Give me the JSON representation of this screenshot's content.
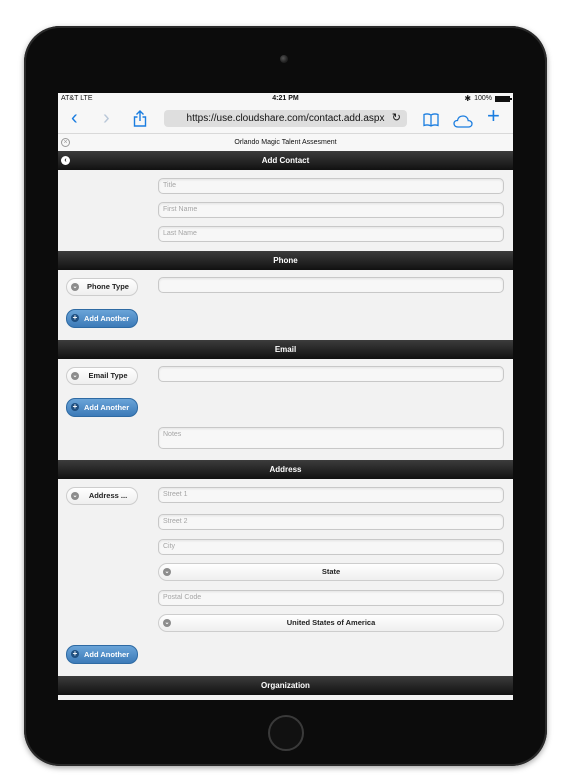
{
  "status_bar": {
    "carrier": "AT&T LTE",
    "time": "4:21 PM",
    "battery": "100%",
    "battery_level": 1.0
  },
  "browser": {
    "url": "https://use.cloudshare.com/contact.add.aspx",
    "page_title": "Orlando Magic Talent Assesment",
    "icons": [
      "back-icon",
      "forward-icon",
      "share-icon",
      "reload-icon",
      "bookmarks-icon",
      "cloud-icon",
      "add-tab-icon"
    ]
  },
  "header": {
    "title": "Add Contact"
  },
  "name_fields": {
    "title_placeholder": "Title",
    "first_name_placeholder": "First Name",
    "last_name_placeholder": "Last Name"
  },
  "phone": {
    "header": "Phone",
    "type_label": "Phone Type",
    "value": "",
    "add_label": "Add Another"
  },
  "email": {
    "header": "Email",
    "type_label": "Email Type",
    "value": "",
    "add_label": "Add Another"
  },
  "notes": {
    "placeholder": "Notes"
  },
  "address": {
    "header": "Address",
    "type_label": "Address ...",
    "street1_placeholder": "Street 1",
    "street2_placeholder": "Street 2",
    "city_placeholder": "City",
    "state_label": "State",
    "postal_placeholder": "Postal Code",
    "country_label": "United States of America",
    "add_label": "Add Another"
  },
  "organization": {
    "header": "Organization"
  }
}
